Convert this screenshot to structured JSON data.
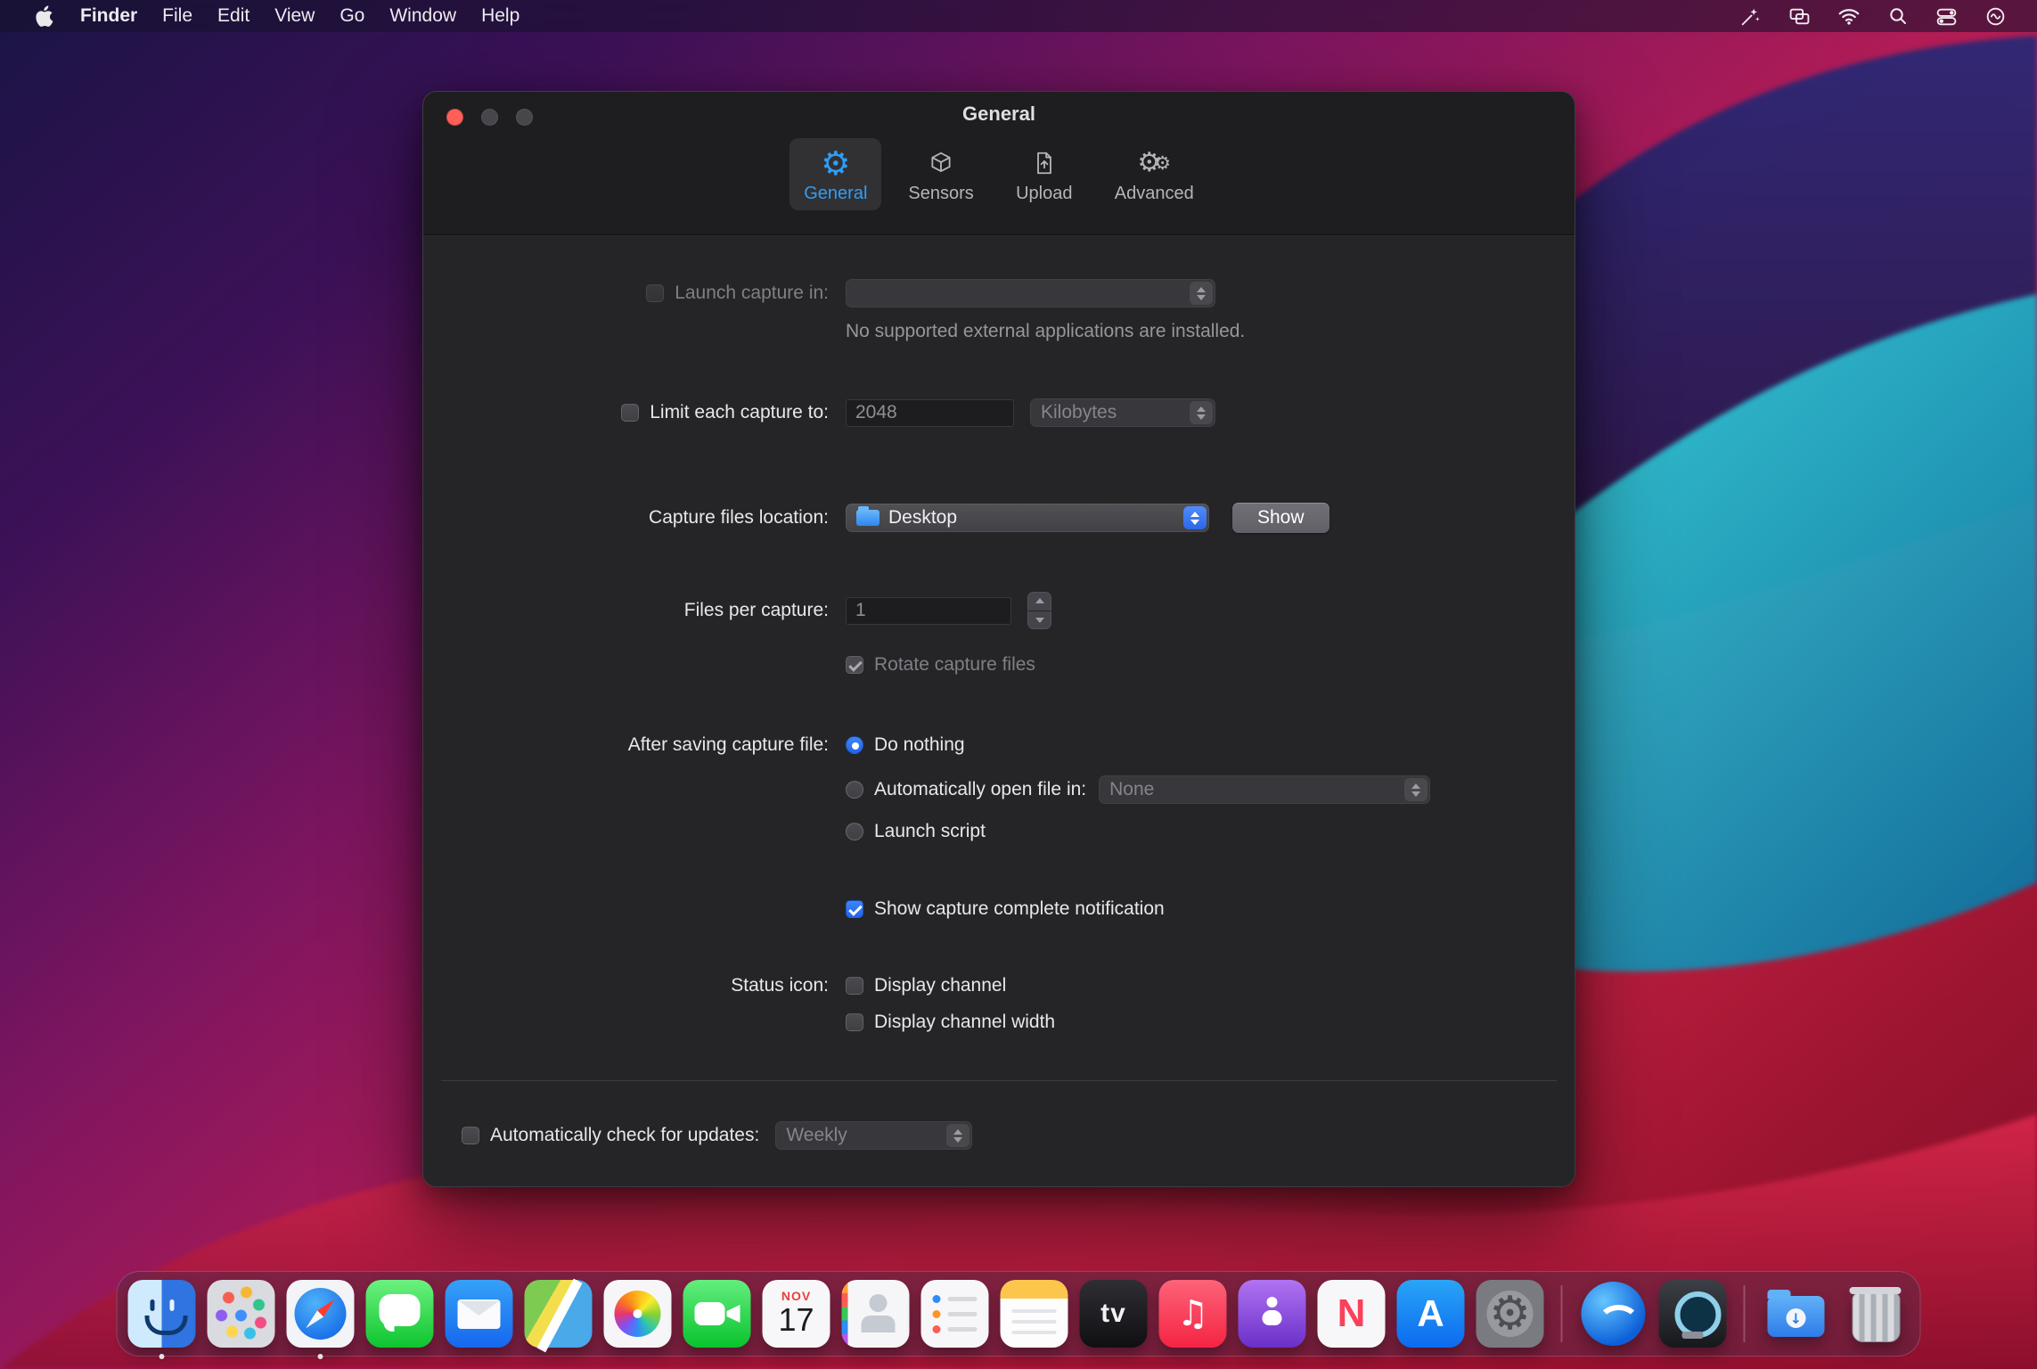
{
  "menu_bar": {
    "app_name": "Finder",
    "menus": [
      "File",
      "Edit",
      "View",
      "Go",
      "Window",
      "Help"
    ]
  },
  "window": {
    "title": "General",
    "tabs": {
      "general": "General",
      "sensors": "Sensors",
      "upload": "Upload",
      "advanced": "Advanced"
    },
    "launch_row": {
      "label": "Launch capture in:",
      "note": "No supported external applications are installed."
    },
    "limit_row": {
      "label": "Limit each capture to:",
      "size": "2048",
      "unit": "Kilobytes"
    },
    "location_row": {
      "label": "Capture files location:",
      "value": "Desktop",
      "show_button": "Show"
    },
    "per_capture_row": {
      "label": "Files per capture:",
      "value": "1",
      "rotate_label": "Rotate capture files"
    },
    "after_row": {
      "label": "After saving capture file:",
      "do_nothing": "Do nothing",
      "open_in": "Automatically open file in:",
      "open_in_value": "None",
      "launch_script": "Launch script",
      "notification": "Show capture complete notification"
    },
    "status_row": {
      "label": "Status icon:",
      "channel": "Display channel",
      "channel_width": "Display channel width"
    },
    "updates_row": {
      "label": "Automatically check for updates:",
      "value": "Weekly"
    }
  },
  "dock": {
    "calendar_month": "NOV",
    "calendar_day": "17"
  },
  "colors": {
    "accent_blue": "#2d7cf6",
    "selected_tab_blue": "#2f9ef7",
    "close_button_red": "#fe5f58"
  }
}
